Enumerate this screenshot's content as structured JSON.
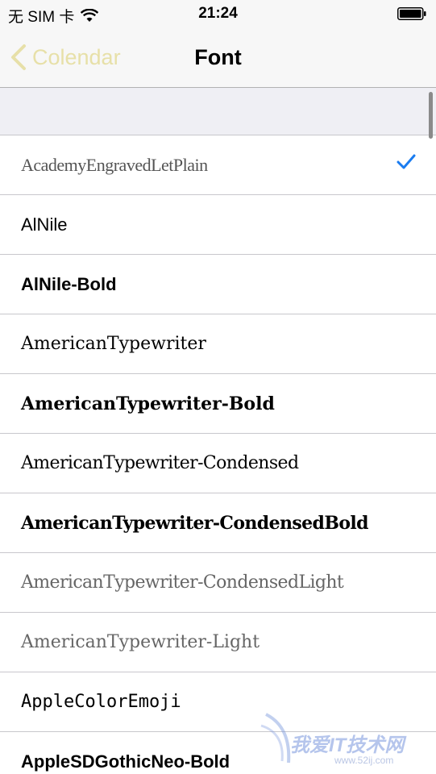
{
  "status_bar": {
    "carrier": "无 SIM 卡",
    "time": "21:24"
  },
  "nav": {
    "back_label": "Colendar",
    "title": "Font"
  },
  "fonts": [
    {
      "label": "AcademyEngravedLetPlain",
      "selected": true
    },
    {
      "label": "AlNile",
      "selected": false
    },
    {
      "label": "AlNile-Bold",
      "selected": false
    },
    {
      "label": "AmericanTypewriter",
      "selected": false
    },
    {
      "label": "AmericanTypewriter-Bold",
      "selected": false
    },
    {
      "label": "AmericanTypewriter-Condensed",
      "selected": false
    },
    {
      "label": "AmericanTypewriter-CondensedBold",
      "selected": false
    },
    {
      "label": "AmericanTypewriter-CondensedLight",
      "selected": false
    },
    {
      "label": "AmericanTypewriter-Light",
      "selected": false
    },
    {
      "label": "AppleColorEmoji",
      "selected": false
    },
    {
      "label": "AppleSDGothicNeo-Bold",
      "selected": false
    }
  ],
  "watermark": {
    "text": "我爱IT技术网",
    "url": "www.52ij.com"
  },
  "colors": {
    "accent": "#1a7cf0",
    "back_tint": "#e7e0a8",
    "group_background": "#efeff4",
    "separator": "#c8c7cc"
  },
  "icons": [
    "wifi-icon",
    "battery-icon",
    "chevron-left-icon",
    "checkmark-icon"
  ]
}
